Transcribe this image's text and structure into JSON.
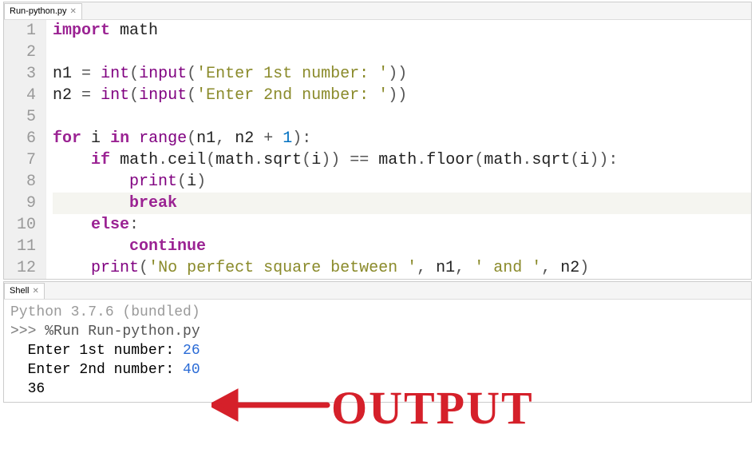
{
  "editorTab": {
    "label": "Run-python.py"
  },
  "shellTab": {
    "label": "Shell"
  },
  "code": {
    "lines": [
      {
        "n": 1,
        "t": [
          [
            "kw",
            "import"
          ],
          [
            "sp",
            " "
          ],
          [
            "id",
            "math"
          ]
        ]
      },
      {
        "n": 2,
        "t": []
      },
      {
        "n": 3,
        "t": [
          [
            "id",
            "n1"
          ],
          [
            "sp",
            " "
          ],
          [
            "op",
            "="
          ],
          [
            "sp",
            " "
          ],
          [
            "bi",
            "int"
          ],
          [
            "paren",
            "("
          ],
          [
            "bi",
            "input"
          ],
          [
            "paren",
            "("
          ],
          [
            "str",
            "'Enter 1st number: '"
          ],
          [
            "paren",
            "))"
          ]
        ]
      },
      {
        "n": 4,
        "t": [
          [
            "id",
            "n2"
          ],
          [
            "sp",
            " "
          ],
          [
            "op",
            "="
          ],
          [
            "sp",
            " "
          ],
          [
            "bi",
            "int"
          ],
          [
            "paren",
            "("
          ],
          [
            "bi",
            "input"
          ],
          [
            "paren",
            "("
          ],
          [
            "str",
            "'Enter 2nd number: '"
          ],
          [
            "paren",
            "))"
          ]
        ]
      },
      {
        "n": 5,
        "t": []
      },
      {
        "n": 6,
        "t": [
          [
            "kw",
            "for"
          ],
          [
            "sp",
            " "
          ],
          [
            "id",
            "i"
          ],
          [
            "sp",
            " "
          ],
          [
            "kw",
            "in"
          ],
          [
            "sp",
            " "
          ],
          [
            "bi",
            "range"
          ],
          [
            "paren",
            "("
          ],
          [
            "id",
            "n1"
          ],
          [
            "op",
            ","
          ],
          [
            "sp",
            " "
          ],
          [
            "id",
            "n2"
          ],
          [
            "sp",
            " "
          ],
          [
            "op",
            "+"
          ],
          [
            "sp",
            " "
          ],
          [
            "num",
            "1"
          ],
          [
            "paren",
            ")"
          ],
          [
            "op",
            ":"
          ]
        ]
      },
      {
        "n": 7,
        "t": [
          [
            "sp",
            "    "
          ],
          [
            "kw",
            "if"
          ],
          [
            "sp",
            " "
          ],
          [
            "id",
            "math"
          ],
          [
            "op",
            "."
          ],
          [
            "id",
            "ceil"
          ],
          [
            "paren",
            "("
          ],
          [
            "id",
            "math"
          ],
          [
            "op",
            "."
          ],
          [
            "id",
            "sqrt"
          ],
          [
            "paren",
            "("
          ],
          [
            "id",
            "i"
          ],
          [
            "paren",
            "))"
          ],
          [
            "sp",
            " "
          ],
          [
            "op",
            "=="
          ],
          [
            "sp",
            " "
          ],
          [
            "id",
            "math"
          ],
          [
            "op",
            "."
          ],
          [
            "id",
            "floor"
          ],
          [
            "paren",
            "("
          ],
          [
            "id",
            "math"
          ],
          [
            "op",
            "."
          ],
          [
            "id",
            "sqrt"
          ],
          [
            "paren",
            "("
          ],
          [
            "id",
            "i"
          ],
          [
            "paren",
            "))"
          ],
          [
            "op",
            ":"
          ]
        ]
      },
      {
        "n": 8,
        "t": [
          [
            "sp",
            "        "
          ],
          [
            "bi",
            "print"
          ],
          [
            "paren",
            "("
          ],
          [
            "id",
            "i"
          ],
          [
            "paren",
            ")"
          ]
        ]
      },
      {
        "n": 9,
        "hl": true,
        "t": [
          [
            "sp",
            "        "
          ],
          [
            "kw",
            "break"
          ]
        ]
      },
      {
        "n": 10,
        "t": [
          [
            "sp",
            "    "
          ],
          [
            "kw",
            "else"
          ],
          [
            "op",
            ":"
          ]
        ]
      },
      {
        "n": 11,
        "t": [
          [
            "sp",
            "        "
          ],
          [
            "kw",
            "continue"
          ]
        ]
      },
      {
        "n": 12,
        "t": [
          [
            "sp",
            "    "
          ],
          [
            "bi",
            "print"
          ],
          [
            "paren",
            "("
          ],
          [
            "str",
            "'No perfect square between '"
          ],
          [
            "op",
            ","
          ],
          [
            "sp",
            " "
          ],
          [
            "id",
            "n1"
          ],
          [
            "op",
            ","
          ],
          [
            "sp",
            " "
          ],
          [
            "str",
            "' and '"
          ],
          [
            "op",
            ","
          ],
          [
            "sp",
            " "
          ],
          [
            "id",
            "n2"
          ],
          [
            "paren",
            ")"
          ]
        ]
      }
    ]
  },
  "shell": {
    "banner": "Python 3.7.6 (bundled)",
    "prompt": ">>> ",
    "command": "%Run Run-python.py",
    "io": [
      {
        "label": "  Enter 1st number: ",
        "value": "26"
      },
      {
        "label": "  Enter 2nd number: ",
        "value": "40"
      }
    ],
    "result": "  36"
  },
  "annotation": {
    "text": "OUTPUT"
  }
}
